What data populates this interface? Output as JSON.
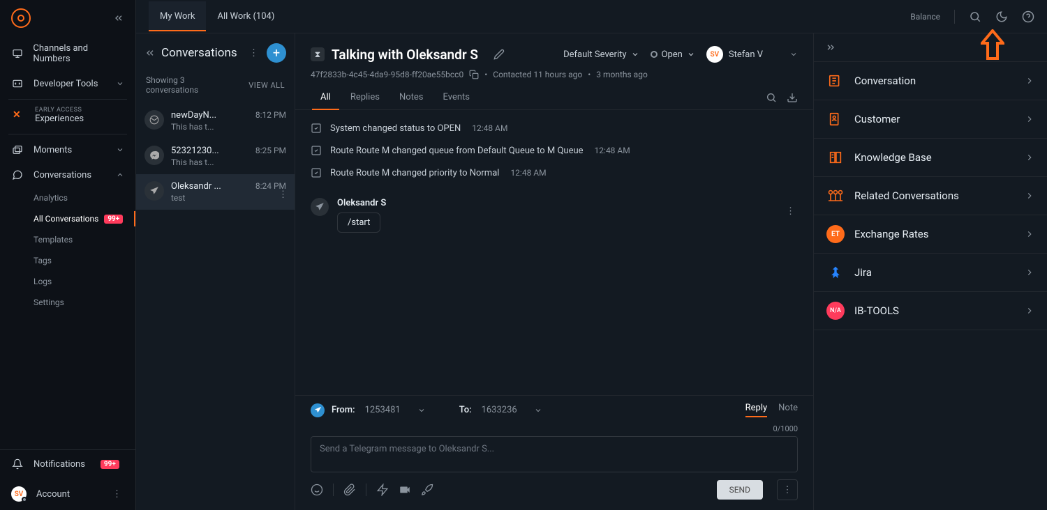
{
  "header": {
    "tabs": [
      {
        "label": "My Work",
        "active": true
      },
      {
        "label": "All Work (104)",
        "active": false
      }
    ],
    "balance_label": "Balance"
  },
  "sidebar": {
    "main_nav": {
      "channels": "Channels and Numbers",
      "developer": "Developer Tools",
      "early_access_label": "EARLY ACCESS",
      "experiences": "Experiences",
      "moments": "Moments",
      "conversations": "Conversations"
    },
    "conversation_sub": [
      {
        "label": "Analytics",
        "active": false,
        "badge": null
      },
      {
        "label": "All Conversations",
        "active": true,
        "badge": "99+"
      },
      {
        "label": "Templates",
        "active": false,
        "badge": null
      },
      {
        "label": "Tags",
        "active": false,
        "badge": null
      },
      {
        "label": "Logs",
        "active": false,
        "badge": null
      },
      {
        "label": "Settings",
        "active": false,
        "badge": null
      }
    ],
    "bottom": {
      "notifications": "Notifications",
      "notifications_badge": "99+",
      "account": "Account",
      "avatar_initials": "SV"
    }
  },
  "convlist": {
    "title": "Conversations",
    "showing": "Showing 3 conversations",
    "view_all": "VIEW ALL",
    "items": [
      {
        "name": "newDayN...",
        "preview": "This has t...",
        "time": "8:12 PM",
        "channel": "email",
        "active": false
      },
      {
        "name": "52321230...",
        "preview": "This has t...",
        "time": "8:25 PM",
        "channel": "messenger",
        "active": false
      },
      {
        "name": "Oleksandr ...",
        "preview": "test",
        "time": "8:24 PM",
        "channel": "telegram",
        "active": true
      }
    ]
  },
  "detail": {
    "title": "Talking with Oleksandr S",
    "id": "47f2833b-4c45-4da9-95d8-ff20ae55bcc0",
    "contacted": "Contacted 11 hours ago",
    "age": "3 months ago",
    "severity": "Default Severity",
    "status": "Open",
    "assignee": "Stefan V",
    "assignee_initials": "SV",
    "tabs": [
      "All",
      "Replies",
      "Notes",
      "Events"
    ],
    "active_tab": "All",
    "events": [
      {
        "text": "System changed status to OPEN",
        "time": "12:48 AM"
      },
      {
        "text": "Route Route M changed queue from Default Queue to M Queue",
        "time": "12:48 AM"
      },
      {
        "text": "Route Route M changed priority to Normal",
        "time": "12:48 AM"
      }
    ],
    "message": {
      "sender": "Oleksandr S",
      "body": "/start"
    }
  },
  "composer": {
    "from_label": "From:",
    "from_value": "1253481",
    "to_label": "To:",
    "to_value": "1633236",
    "tabs": [
      "Reply",
      "Note"
    ],
    "active_tab": "Reply",
    "char_count": "0/1000",
    "placeholder": "Send a Telegram message to Oleksandr S...",
    "send": "SEND"
  },
  "rpanel": {
    "items": [
      {
        "label": "Conversation",
        "icon": "conversation"
      },
      {
        "label": "Customer",
        "icon": "customer"
      },
      {
        "label": "Knowledge Base",
        "icon": "kb"
      },
      {
        "label": "Related Conversations",
        "icon": "related"
      },
      {
        "label": "Exchange Rates",
        "icon": "et"
      },
      {
        "label": "Jira",
        "icon": "jira"
      },
      {
        "label": "IB-TOOLS",
        "icon": "na"
      }
    ]
  }
}
